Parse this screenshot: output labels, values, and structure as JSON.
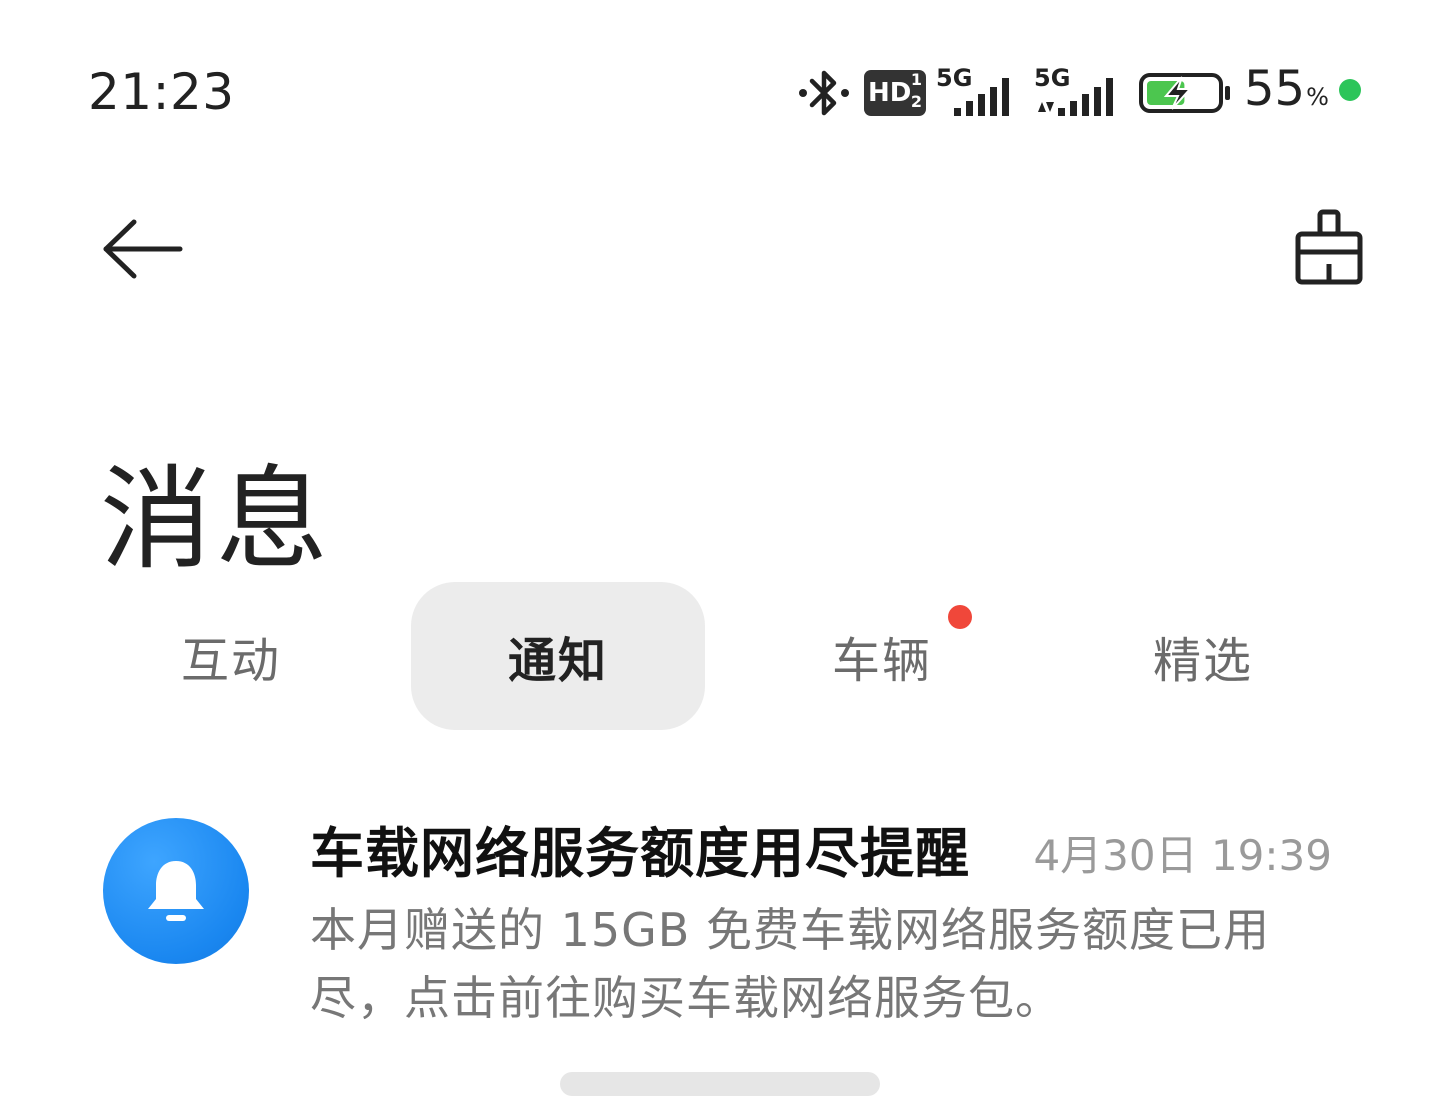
{
  "status_bar": {
    "time": "21:23",
    "icons": [
      "bluetooth-icon",
      "hd-voice-icon",
      "signal-5g-sim1-icon",
      "signal-5g-sim2-icon",
      "battery-charging-icon"
    ],
    "hd_label": "HD",
    "hd_sub_top": "1",
    "hd_sub_bottom": "2",
    "network_1": "5G",
    "network_2": "5G",
    "battery_percent": "55",
    "battery_percent_sign": "%",
    "battery_level": 0.55,
    "battery_fill_color": "#4cc64f"
  },
  "header": {
    "back_icon": "arrow-left-icon",
    "clear_icon": "broom-clear-icon"
  },
  "page": {
    "title": "消息"
  },
  "tabs": [
    {
      "label": "互动",
      "active": false,
      "badge": false
    },
    {
      "label": "通知",
      "active": true,
      "badge": false
    },
    {
      "label": "车辆",
      "active": false,
      "badge": true
    },
    {
      "label": "精选",
      "active": false,
      "badge": false
    }
  ],
  "notifications": [
    {
      "icon": "bell-icon",
      "icon_color": "#1a87f0",
      "title": "车载网络服务额度用尽提醒",
      "time": "4月30日 19:39",
      "body": "本月赠送的 15GB 免费车载网络服务额度已用尽，点击前往购买车载网络服务包。"
    }
  ],
  "colors": {
    "accent_red": "#f0473a",
    "status_green": "#2cc55a",
    "tab_active_bg": "#ececec"
  }
}
